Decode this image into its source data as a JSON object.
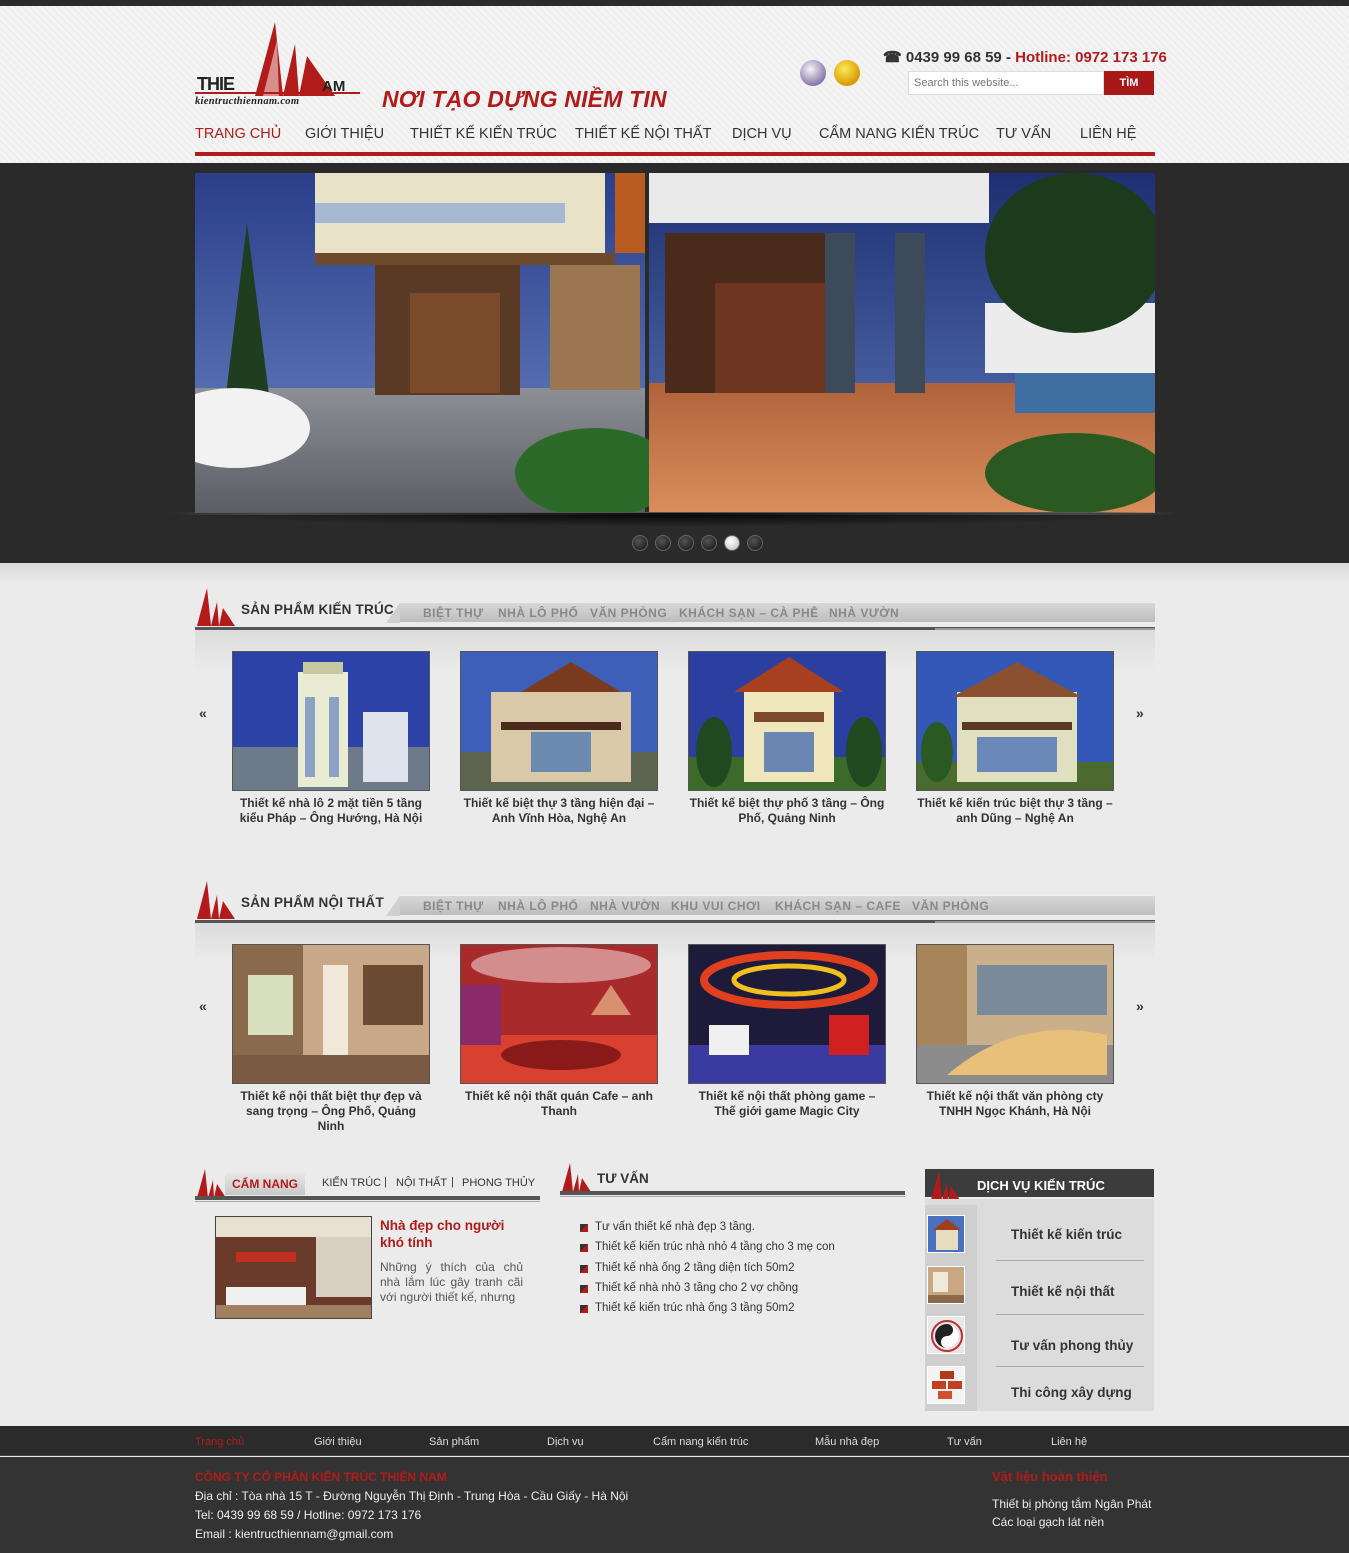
{
  "header": {
    "logo_text_left": "THIE",
    "logo_text_right": "AM",
    "logo_url": "kientructhiennam.com",
    "slogan": "NƠI TẠO DỰNG NIỀM TIN",
    "phone": "☎ 0439 99 68 59 - ",
    "hotline_label": "Hotline: 0972 173 176",
    "search_placeholder": "Search this website...",
    "search_button": "TÌM"
  },
  "nav": [
    "TRANG CHỦ",
    "GIỚI THIỆU",
    "THIẾT KẾ KIẾN TRÚC",
    "THIẾT KẾ NỘI THẤT",
    "DỊCH VỤ",
    "CẨM NANG KIẾN TRÚC",
    "TƯ VẤN",
    "LIÊN HỆ"
  ],
  "slider": {
    "dot_count": 6,
    "active_dot": 5
  },
  "architecture": {
    "title": "SẢN PHẨM KIẾN TRÚC",
    "tabs": [
      "BIỆT THỰ",
      "NHÀ LÔ PHỐ",
      "VĂN PHÒNG",
      "KHÁCH SẠN – CÀ PHÊ",
      "NHÀ VƯỜN"
    ],
    "items": [
      "Thiết kế nhà lô 2 mặt tiền 5 tầng kiểu Pháp – Ông Hướng, Hà Nội",
      "Thiết kế biệt thự 3 tầng hiện đại – Anh Vĩnh Hòa, Nghệ An",
      "Thiết kế biệt thự phố 3 tầng – Ông Phố, Quảng Ninh",
      "Thiết kế kiến trúc biệt thự 3 tầng – anh Dũng – Nghệ An"
    ]
  },
  "interior": {
    "title": "SẢN PHẨM NỘI THẤT",
    "tabs": [
      "BIỆT THỰ",
      "NHÀ LÔ PHỐ",
      "NHÀ VƯỜN",
      "KHU VUI CHƠI",
      "KHÁCH SẠN – CAFE",
      "VĂN PHÒNG"
    ],
    "items": [
      "Thiết kế nội thất biệt thự đẹp và sang trọng – Ông Phố, Quảng Ninh",
      "Thiết kế nội thất quán Cafe – anh Thanh",
      "Thiết kế nội thất phòng game – Thế giới game Magic City",
      "Thiết kế nội thất văn phòng cty TNHH Ngọc Khánh, Hà Nội"
    ]
  },
  "camnang": {
    "tab": "CẨM NANG",
    "links": [
      "KIẾN TRÚC",
      "NỘI THẤT",
      "PHONG THỦY"
    ],
    "article_title": "Nhà đẹp cho người khó tính",
    "article_text": "Những ý thích của chủ nhà lắm lúc gây tranh cãi với người thiết kế, nhưng"
  },
  "tuvan": {
    "title": "TƯ VẤN",
    "items": [
      "Tư vấn thiết kế nhà đẹp 3 tầng.",
      "Thiết kế kiến trúc nhà nhỏ 4 tầng cho 3 mẹ con",
      "Thiết kế nhà ống 2 tầng diện tích 50m2",
      "Thiết kế nhà nhỏ 3 tầng cho 2 vợ chồng",
      "Thiết kế kiến trúc nhà ống 3 tầng 50m2"
    ]
  },
  "dichvu": {
    "title": "DỊCH VỤ KIẾN TRÚC",
    "items": [
      "Thiết kế kiến trúc",
      "Thiết kế nội thất",
      "Tư vấn phong thủy",
      "Thi công xây dựng"
    ]
  },
  "footer_nav": [
    "Trang chủ",
    "Giới thiệu",
    "Sản phẩm",
    "Dịch vụ",
    "Cẩm nang kiến trúc",
    "Mẫu nhà đẹp",
    "Tư vấn",
    "Liên hệ"
  ],
  "footer": {
    "company": "CÔNG TY CỔ PHẦN KIẾN TRÚC THIÊN NAM",
    "address": "Địa chỉ : Tòa nhà 15 T - Đường Nguyễn Thị Định - Trung Hòa - Cầu Giấy - Hà Nội",
    "tel": "Tel: 0439 99 68 59 / Hotline: 0972 173 176",
    "email": "Email : kientructhiennam@gmail.com",
    "right_title": "Vật liệu hoàn thiện",
    "right_links": [
      "Thiết bị phòng tắm Ngân Phát",
      "Các loại gạch lát nền"
    ]
  },
  "colors": {
    "accent": "#b31b1b",
    "dark": "#2b2b2b"
  }
}
